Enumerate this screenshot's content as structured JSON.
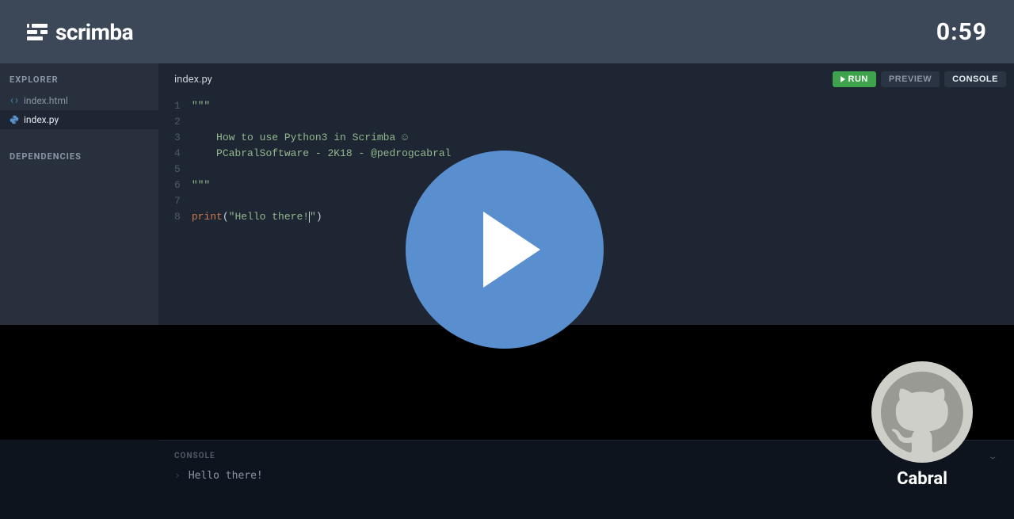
{
  "header": {
    "brand": "scrimba",
    "timer": "0:59"
  },
  "sidebar": {
    "explorer_label": "EXPLORER",
    "dependencies_label": "DEPENDENCIES",
    "files": [
      {
        "name": "index.html",
        "icon": "html-icon",
        "active": false
      },
      {
        "name": "index.py",
        "icon": "py-icon",
        "active": true
      }
    ]
  },
  "editor": {
    "active_tab": "index.py",
    "buttons": {
      "run": "RUN",
      "preview": "PREVIEW",
      "console": "CONSOLE"
    },
    "code_lines": [
      {
        "n": 1,
        "type": "str",
        "indent": 0,
        "text": "\"\"\""
      },
      {
        "n": 2,
        "type": "blank",
        "indent": 0,
        "text": ""
      },
      {
        "n": 3,
        "type": "str",
        "indent": 1,
        "text": "How to use Python3 in Scrimba ☺"
      },
      {
        "n": 4,
        "type": "str",
        "indent": 1,
        "text": "PCabralSoftware - 2K18 - @pedrogcabral"
      },
      {
        "n": 5,
        "type": "blank",
        "indent": 0,
        "text": ""
      },
      {
        "n": 6,
        "type": "str",
        "indent": 0,
        "text": "\"\"\""
      },
      {
        "n": 7,
        "type": "blank",
        "indent": 0,
        "text": ""
      },
      {
        "n": 8,
        "type": "print",
        "indent": 0,
        "func": "print",
        "arg": "\"Hello there!\""
      }
    ]
  },
  "console": {
    "label": "CONSOLE",
    "output": "Hello there!"
  },
  "user": {
    "name": "Cabral"
  }
}
